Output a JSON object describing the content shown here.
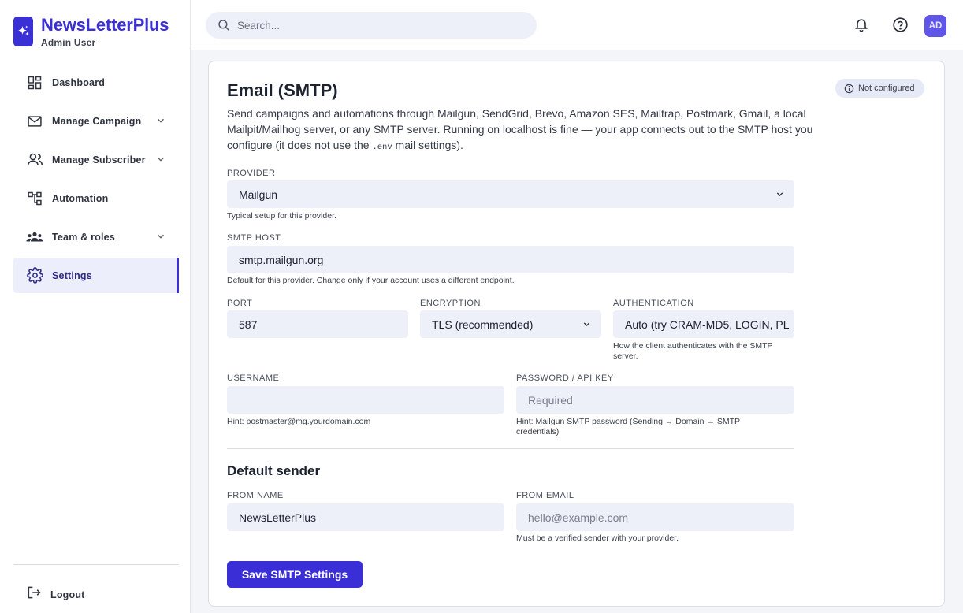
{
  "brand": {
    "name": "NewsLetterPlus",
    "user": "Admin User",
    "logo_icon": "sparkle-icon",
    "color": "#3b2fd6"
  },
  "sidebar": {
    "items": [
      {
        "label": "Dashboard",
        "icon": "dashboard-icon",
        "has_chevron": false,
        "active": false
      },
      {
        "label": "Manage Campaign",
        "icon": "mail-icon",
        "has_chevron": true,
        "active": false
      },
      {
        "label": "Manage Subscriber",
        "icon": "users-icon",
        "has_chevron": true,
        "active": false
      },
      {
        "label": "Automation",
        "icon": "workflow-icon",
        "has_chevron": false,
        "active": false
      },
      {
        "label": "Team & roles",
        "icon": "team-icon",
        "has_chevron": true,
        "active": false
      },
      {
        "label": "Settings",
        "icon": "gear-icon",
        "has_chevron": false,
        "active": true
      }
    ],
    "logout_label": "Logout"
  },
  "topbar": {
    "search_placeholder": "Search...",
    "avatar_initials": "AD"
  },
  "page": {
    "title": "Email (SMTP)",
    "status": "Not configured",
    "description_pre": "Send campaigns and automations through Mailgun, SendGrid, Brevo, Amazon SES, Mailtrap, Postmark, Gmail, a local Mailpit/Mailhog server, or any SMTP server. Running on localhost is fine — your app connects out to the SMTP host you configure (it does not use the ",
    "description_code": ".env",
    "description_post": " mail settings).",
    "provider": {
      "label": "PROVIDER",
      "value": "Mailgun",
      "hint": "Typical setup for this provider."
    },
    "smtp_host": {
      "label": "SMTP HOST",
      "value": "smtp.mailgun.org",
      "hint": "Default for this provider. Change only if your account uses a different endpoint."
    },
    "port": {
      "label": "PORT",
      "value": "587"
    },
    "encryption": {
      "label": "ENCRYPTION",
      "value": "TLS (recommended)"
    },
    "authentication": {
      "label": "AUTHENTICATION",
      "value": "Auto (try CRAM-MD5, LOGIN, PL",
      "hint": "How the client authenticates with the SMTP server."
    },
    "username": {
      "label": "USERNAME",
      "value": "",
      "hint": "Hint: postmaster@mg.yourdomain.com"
    },
    "password": {
      "label": "PASSWORD / API KEY",
      "placeholder": "Required",
      "hint": "Hint: Mailgun SMTP password (Sending → Domain → SMTP credentials)"
    },
    "default_sender_title": "Default sender",
    "from_name": {
      "label": "FROM NAME",
      "value": "NewsLetterPlus"
    },
    "from_email": {
      "label": "FROM EMAIL",
      "placeholder": "hello@example.com",
      "hint": "Must be a verified sender with your provider."
    },
    "save_label": "Save SMTP Settings"
  }
}
